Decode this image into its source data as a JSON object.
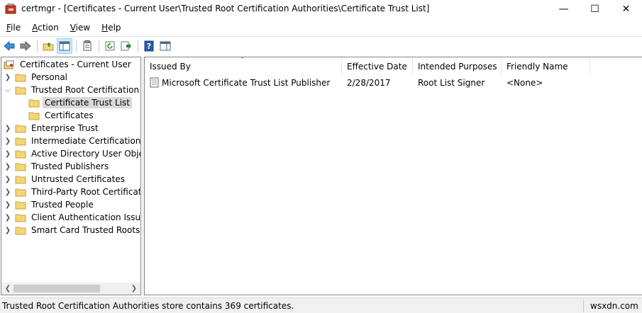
{
  "window": {
    "title": "certmgr - [Certificates - Current User\\Trusted Root Certification Authorities\\Certificate Trust List]",
    "minimize": "—",
    "maximize": "☐",
    "close": "✕"
  },
  "menu": {
    "items": [
      {
        "key": "F",
        "rest": "ile"
      },
      {
        "key": "A",
        "rest": "ction"
      },
      {
        "key": "V",
        "rest": "iew"
      },
      {
        "key": "H",
        "rest": "elp"
      }
    ]
  },
  "toolbar": {
    "icons": [
      "back-arrow-icon",
      "forward-arrow-icon",
      "up-folder-icon",
      "show-hide-tree-icon",
      "properties-icon",
      "refresh-icon",
      "export-list-icon",
      "help-icon",
      "action-pane-icon"
    ]
  },
  "tree": {
    "root": "Certificates - Current User",
    "items": [
      {
        "label": "Personal",
        "expanded": false
      },
      {
        "label": "Trusted Root Certification Au",
        "expanded": true
      },
      {
        "label": "Certificate Trust List",
        "child": true,
        "selected": true
      },
      {
        "label": "Certificates",
        "child": true
      },
      {
        "label": "Enterprise Trust",
        "expanded": false
      },
      {
        "label": "Intermediate Certification Au",
        "expanded": false
      },
      {
        "label": "Active Directory User Object",
        "expanded": false
      },
      {
        "label": "Trusted Publishers",
        "expanded": false
      },
      {
        "label": "Untrusted Certificates",
        "expanded": false
      },
      {
        "label": "Third-Party Root Certification",
        "expanded": false
      },
      {
        "label": "Trusted People",
        "expanded": false
      },
      {
        "label": "Client Authentication Issuers",
        "expanded": false
      },
      {
        "label": "Smart Card Trusted Roots",
        "expanded": false
      }
    ]
  },
  "list": {
    "columns": [
      "Issued By",
      "Effective Date",
      "Intended Purposes",
      "Friendly Name"
    ],
    "rows": [
      [
        "Microsoft Certificate Trust List Publisher",
        "2/28/2017",
        "Root List Signer",
        "<None>"
      ]
    ]
  },
  "status": {
    "text": "Trusted Root Certification Authorities store contains 369 certificates.",
    "watermark": "wsxdn.com"
  },
  "colors": {
    "folder": "#f3d67a",
    "selection": "#d9d9d9",
    "toolbar_pressed": "#cce8ff"
  }
}
